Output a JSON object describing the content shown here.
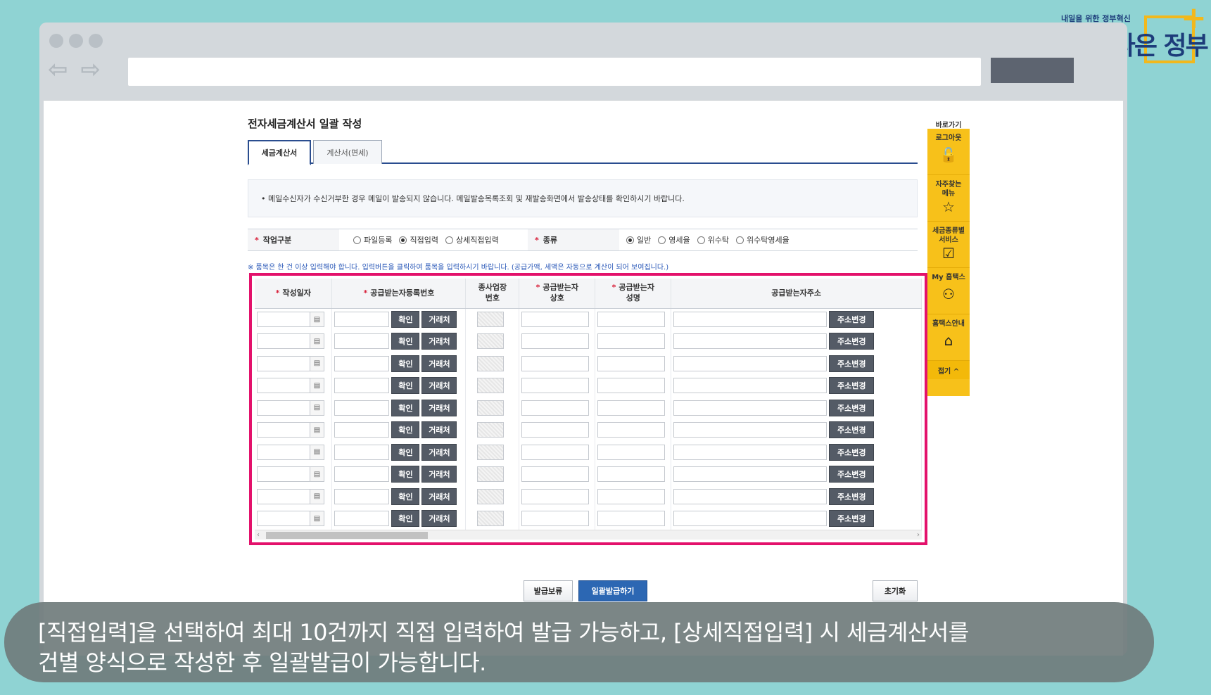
{
  "logo": {
    "tagline": "내일을 위한 정부혁신",
    "name": "보다 나은 정부"
  },
  "page": {
    "title": "전자세금계산서 일괄 작성"
  },
  "tabs": [
    {
      "label": "세금계산서",
      "active": true
    },
    {
      "label": "계산서(면세)",
      "active": false
    }
  ],
  "notice": "• 메일수신자가 수신거부한 경우 메일이 발송되지 않습니다. 메일발송목록조회 및 재발송화면에서 발송상태를 확인하시기 바랍니다.",
  "options": {
    "work_type": {
      "label": "작업구분",
      "choices": [
        "파일등록",
        "직접입력",
        "상세직접입력"
      ],
      "selected": "직접입력"
    },
    "kind": {
      "label": "종류",
      "choices": [
        "일반",
        "영세율",
        "위수탁",
        "위수탁영세율"
      ],
      "selected": "일반"
    }
  },
  "hint": "※ 품목은 한 건 이상 입력해야 합니다. 입력버튼을 클릭하여 품목을 입력하시기 바랍니다. (공급가액, 세액은 자동으로 계산이 되어 보여집니다.)",
  "table": {
    "headers": {
      "date": "작성일자",
      "reg_no": "공급받는자등록번호",
      "sub_biz_1": "종사업장",
      "sub_biz_2": "번호",
      "trade_name_1": "공급받는자",
      "trade_name_2": "상호",
      "rep_name_1": "공급받는자",
      "rep_name_2": "성명",
      "address": "공급받는자주소"
    },
    "row_count": 10,
    "buttons": {
      "confirm": "확인",
      "partner": "거래처",
      "address_change": "주소변경"
    }
  },
  "actions": {
    "hold": "발급보류",
    "bulk_issue": "일괄발급하기",
    "reset": "초기화"
  },
  "quick_menu": {
    "title": "바로가기",
    "items": [
      {
        "label": "로그아웃",
        "icon": "unlock-icon"
      },
      {
        "label": "자주찾는\n메뉴",
        "icon": "star-icon"
      },
      {
        "label": "세금종류별\n서비스",
        "icon": "checkbox-icon"
      },
      {
        "label": "My 홈택스",
        "icon": "user-icon"
      },
      {
        "label": "홈택스안내",
        "icon": "home-icon"
      }
    ],
    "fold": "접기 ^"
  },
  "caption": {
    "line1": "[직접입력]을 선택하여 최대 10건까지 직접 입력하여 발급 가능하고, [상세직접입력] 시 세금계산서를",
    "line2": "건별 양식으로 작성한 후 일괄발급이 가능합니다."
  },
  "colors": {
    "highlight": "#e3116b",
    "primary_button": "#2c67b3",
    "quick_menu": "#f7c11a",
    "background": "#8fd3d3"
  }
}
